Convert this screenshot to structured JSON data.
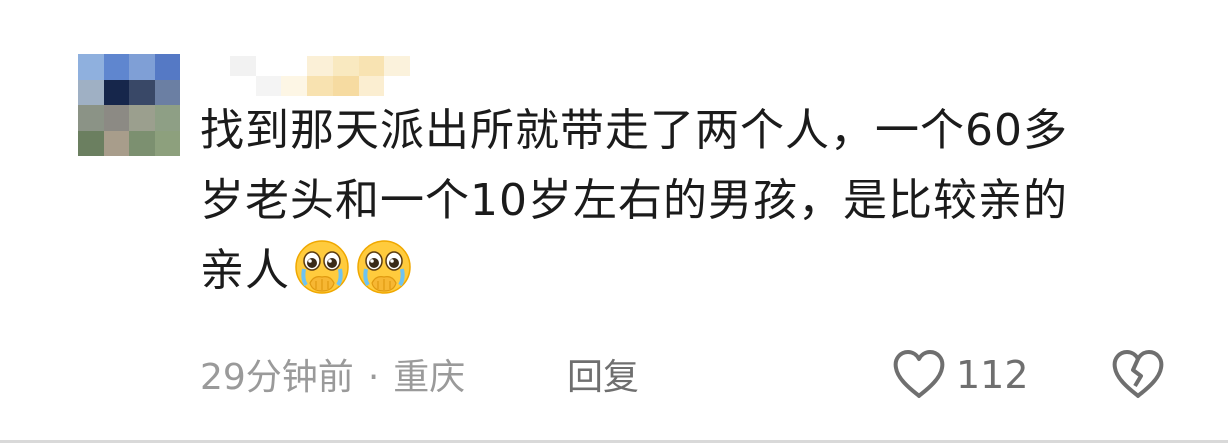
{
  "comment": {
    "line1": "找到那天派出所就带走了两个人，一个60多",
    "line2": "岁老头和一个10岁左右的男孩，是比较亲的",
    "line3": "亲人",
    "emojis": [
      "pleading-face-emoji",
      "pleading-face-emoji"
    ]
  },
  "meta": {
    "time": "29分钟前",
    "separator": "·",
    "location": "重庆"
  },
  "actions": {
    "reply_label": "回复",
    "like_count": "112"
  },
  "avatar": {
    "pixels": [
      "#8fb0de",
      "#5f86cf",
      "#7f9fd6",
      "#5579c5",
      "#9fb0c4",
      "#16264b",
      "#394867",
      "#6b7fa3",
      "#8b9386",
      "#8c8a84",
      "#9b9f8e",
      "#8e9f85",
      "#6b7f60",
      "#a89d8b",
      "#7c9070",
      "#8da07d"
    ]
  },
  "username": {
    "pixels": [
      "#f2f2f2",
      "#ffffff",
      "#ffffff",
      "#fbf0d7",
      "#f9e9c0",
      "#f8e3b2",
      "#fbf2dc",
      "#ffffff",
      "#f4f4f4",
      "#fdf6e5",
      "#f8e2b0",
      "#f6dba1",
      "#fbeed1",
      "#ffffff"
    ]
  },
  "colors": {
    "text": "#1b1b1b",
    "meta": "#9a9a9a",
    "action": "#6f6f6f"
  }
}
